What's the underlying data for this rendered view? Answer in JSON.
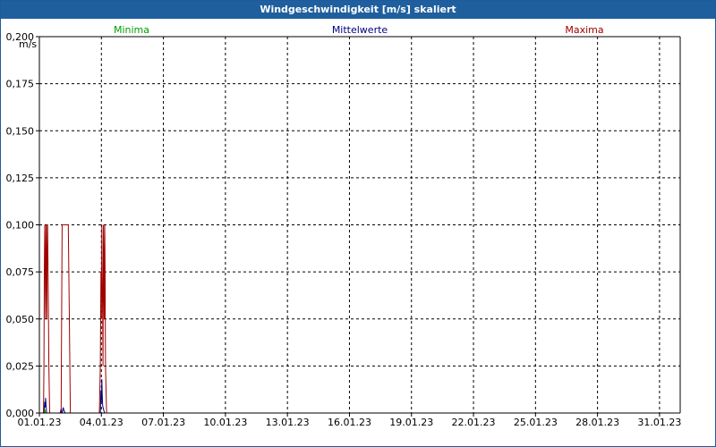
{
  "window": {
    "title": "Windgeschwindigkeit [m/s] skaliert"
  },
  "chart_data": {
    "type": "line",
    "title": "Windgeschwindigkeit [m/s] skaliert",
    "ylabel": "m/s",
    "xlabel": "",
    "ylim": [
      0,
      0.2
    ],
    "xlim_days": [
      1,
      32
    ],
    "grid": true,
    "legend_placement": "top",
    "y_ticks": [
      "0,000",
      "0,025",
      "0,050",
      "0,075",
      "0,100",
      "0,125",
      "0,150",
      "0,175",
      "0,200"
    ],
    "y_tick_values": [
      0,
      0.025,
      0.05,
      0.075,
      0.1,
      0.125,
      0.15,
      0.175,
      0.2
    ],
    "x_ticks": [
      "01.01.23",
      "04.01.23",
      "07.01.23",
      "10.01.23",
      "13.01.23",
      "16.01.23",
      "19.01.23",
      "22.01.23",
      "25.01.23",
      "28.01.23",
      "31.01.23"
    ],
    "x_tick_days": [
      1,
      4,
      7,
      10,
      13,
      16,
      19,
      22,
      25,
      28,
      31
    ],
    "series": [
      {
        "name": "Minima",
        "color": "#00a000",
        "x": [
          1,
          1.2,
          1.22,
          1.24,
          1.26,
          1.3,
          1.4,
          1.5,
          1.6,
          3.9,
          4.0,
          4.1,
          32
        ],
        "values": [
          0,
          0,
          0.002,
          0,
          0.002,
          0,
          0,
          0,
          0,
          0,
          0,
          0,
          0
        ]
      },
      {
        "name": "Mittelwerte",
        "color": "#000080",
        "x": [
          1,
          1.2,
          1.22,
          1.24,
          1.26,
          1.28,
          1.3,
          1.35,
          2.0,
          2.05,
          2.1,
          2.15,
          2.2,
          2.25,
          3.95,
          3.98,
          4.0,
          4.02,
          4.04,
          4.06,
          4.1,
          4.15,
          32
        ],
        "values": [
          0,
          0,
          0.004,
          0.002,
          0.006,
          0.003,
          0.008,
          0,
          0,
          0.002,
          0,
          0.003,
          0.001,
          0,
          0,
          0.012,
          0.006,
          0.018,
          0.01,
          0.004,
          0.002,
          0,
          0
        ]
      },
      {
        "name": "Maxima",
        "color": "#a00000",
        "x": [
          1,
          1.2,
          1.22,
          1.24,
          1.26,
          1.28,
          1.3,
          1.32,
          1.34,
          1.36,
          1.38,
          1.4,
          1.42,
          1.44,
          1.46,
          1.5,
          1.55,
          2.0,
          2.05,
          2.1,
          2.15,
          2.2,
          2.25,
          2.3,
          2.35,
          2.4,
          2.45,
          2.5,
          3.9,
          3.95,
          3.98,
          4.0,
          4.02,
          4.04,
          4.06,
          4.08,
          4.1,
          4.12,
          4.14,
          4.16,
          4.18,
          4.2,
          4.25,
          32
        ],
        "values": [
          0,
          0,
          0.025,
          0.075,
          0.1,
          0.075,
          0.05,
          0.1,
          0.075,
          0.05,
          0.1,
          0.1,
          0.075,
          0.05,
          0.025,
          0,
          0,
          0,
          0,
          0.1,
          0.1,
          0.1,
          0.1,
          0.1,
          0.1,
          0.1,
          0.05,
          0,
          0,
          0.025,
          0.075,
          0.05,
          0.1,
          0.075,
          0.05,
          0.025,
          0.1,
          0.075,
          0.05,
          0.1,
          0.075,
          0.025,
          0,
          0
        ]
      }
    ]
  }
}
